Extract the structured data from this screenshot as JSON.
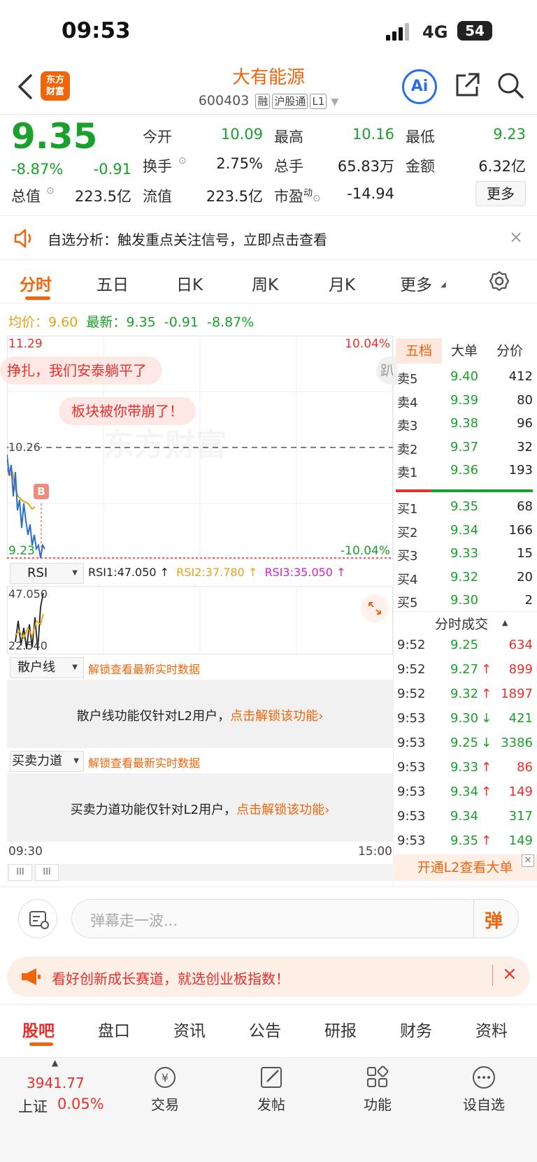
{
  "status": {
    "time": "09:53",
    "network": "4G",
    "battery": "54"
  },
  "header": {
    "title": "大有能源",
    "code": "600403",
    "tags": [
      "融",
      "沪股通",
      "L1"
    ],
    "ai": "Ai"
  },
  "quote": {
    "price": "9.35",
    "pct": "-8.87%",
    "chg": "-0.91",
    "open_label": "今开",
    "open": "10.09",
    "high_label": "最高",
    "high": "10.16",
    "low_label": "最低",
    "low": "9.23",
    "turnover_label": "换手",
    "turnover": "2.75%",
    "vol_label": "总手",
    "vol": "65.83万",
    "amount_label": "金额",
    "amount": "6.32亿",
    "mcap_label": "总值",
    "mcap": "223.5亿",
    "float_label": "流值",
    "float": "223.5亿",
    "pe_label": "市盈",
    "pe_sup": "动",
    "pe": "-14.94",
    "more": "更多"
  },
  "notice": {
    "text": "自选分析：触发重点关注信号，立即点击查看"
  },
  "chart_tabs": [
    "分时",
    "五日",
    "日K",
    "周K",
    "月K",
    "更多"
  ],
  "intraday": {
    "avg_label": "均价：",
    "avg": "9.60",
    "last_label": "最新：",
    "last": "9.35",
    "chg": "-0.91",
    "pct": "-8.87%",
    "y_top": "11.29",
    "y_top_pct": "10.04%",
    "y_mid": "10.26",
    "y_bot": "9.23",
    "y_bot_pct": "-10.04%",
    "start": "09:30",
    "end": "15:00",
    "danmaku1": "挣扎，我们安泰躺平了",
    "danmaku2": "板块被你带崩了！",
    "danmaku3": "趴",
    "marker": "B",
    "watermark": "东方财富"
  },
  "rsi": {
    "name": "RSI",
    "rsi1": "RSI1:47.050 ↑",
    "rsi2": "RSI2:37.780 ↑",
    "rsi3": "RSI3:35.050 ↑",
    "top": "47.050",
    "bottom": "22.540"
  },
  "l2_panels": [
    {
      "name": "散户线",
      "hint": "解锁查看最新实时数据",
      "msg": "散户线功能仅针对L2用户，",
      "link": "点击解锁该功能"
    },
    {
      "name": "买卖力道",
      "hint": "解锁查看最新实时数据",
      "msg": "买卖力道功能仅针对L2用户，",
      "link": "点击解锁该功能"
    }
  ],
  "orderbook": {
    "tabs": [
      "五档",
      "大单",
      "分价"
    ],
    "asks": [
      {
        "label": "卖5",
        "price": "9.40",
        "vol": "412"
      },
      {
        "label": "卖4",
        "price": "9.39",
        "vol": "80"
      },
      {
        "label": "卖3",
        "price": "9.38",
        "vol": "96"
      },
      {
        "label": "卖2",
        "price": "9.37",
        "vol": "32"
      },
      {
        "label": "卖1",
        "price": "9.36",
        "vol": "193"
      }
    ],
    "bids": [
      {
        "label": "买1",
        "price": "9.35",
        "vol": "68"
      },
      {
        "label": "买2",
        "price": "9.34",
        "vol": "166"
      },
      {
        "label": "买3",
        "price": "9.33",
        "vol": "15"
      },
      {
        "label": "买4",
        "price": "9.32",
        "vol": "20"
      },
      {
        "label": "买5",
        "price": "9.30",
        "vol": "2"
      }
    ]
  },
  "trades": {
    "title": "分时成交",
    "rows": [
      {
        "t": "9:52",
        "p": "9.25",
        "a": "",
        "v": "634",
        "c": "red"
      },
      {
        "t": "9:52",
        "p": "9.27",
        "a": "↑",
        "v": "899",
        "c": "red"
      },
      {
        "t": "9:52",
        "p": "9.32",
        "a": "↑",
        "v": "1897",
        "c": "red"
      },
      {
        "t": "9:53",
        "p": "9.30",
        "a": "↓",
        "v": "421",
        "c": "green"
      },
      {
        "t": "9:53",
        "p": "9.25",
        "a": "↓",
        "v": "3386",
        "c": "green"
      },
      {
        "t": "9:53",
        "p": "9.33",
        "a": "↑",
        "v": "86",
        "c": "red"
      },
      {
        "t": "9:53",
        "p": "9.34",
        "a": "↑",
        "v": "149",
        "c": "red"
      },
      {
        "t": "9:53",
        "p": "9.34",
        "a": "",
        "v": "317",
        "c": "green"
      },
      {
        "t": "9:53",
        "p": "9.35",
        "a": "↑",
        "v": "149",
        "c": "green"
      }
    ],
    "l2_btn": "开通L2查看大单"
  },
  "danmaku_input": {
    "placeholder": "弹幕走一波...",
    "send": "弹"
  },
  "promo": {
    "text": "看好创新成长赛道，就选创业板指数！"
  },
  "bottom_tabs": [
    "股吧",
    "盘口",
    "资讯",
    "公告",
    "研报",
    "财务",
    "资料"
  ],
  "nav": {
    "index_value": "3941.77",
    "index_name": "上证",
    "index_pct": "0.05%",
    "items": [
      "交易",
      "发帖",
      "功能",
      "设自选"
    ]
  }
}
